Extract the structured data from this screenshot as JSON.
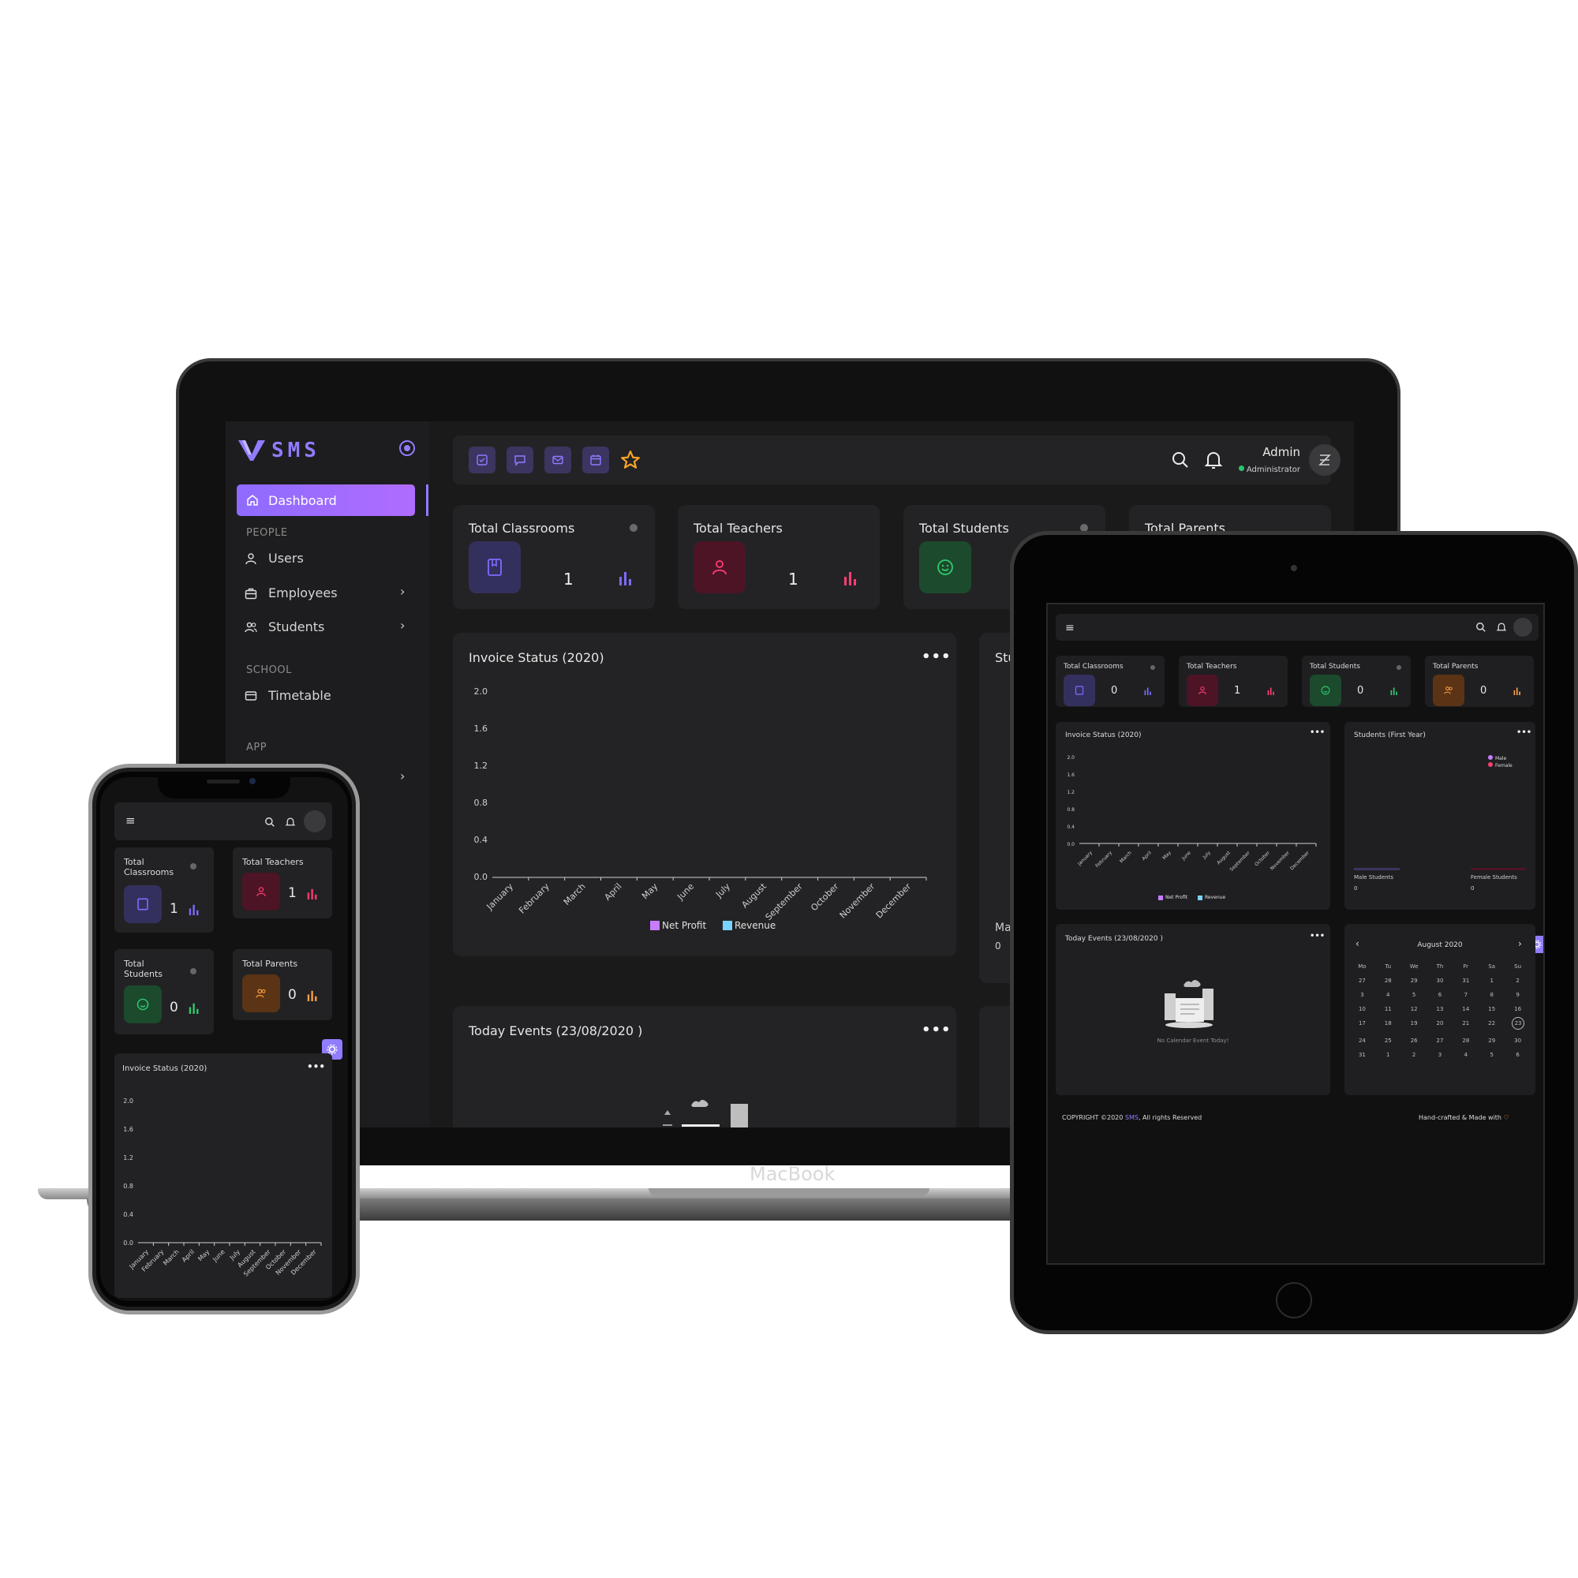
{
  "laptop": {
    "label": "MacBook",
    "app": {
      "logo_text": "SMS",
      "nav": {
        "dashboard": "Dashboard",
        "section_people": "PEOPLE",
        "users": "Users",
        "employees": "Employees",
        "students": "Students",
        "section_school": "SCHOOL",
        "timetable": "Timetable",
        "section_app": "APP"
      },
      "topbar": {
        "admin_name": "Admin",
        "admin_role": "Administrator"
      },
      "cards": [
        {
          "title": "Total Classrooms",
          "value": "1",
          "color": "#7b6cff"
        },
        {
          "title": "Total Teachers",
          "value": "1",
          "color": "#ff3d71"
        },
        {
          "title": "Total Students",
          "value": "",
          "color": "#2ecc71"
        },
        {
          "title": "Total Parents",
          "value": "",
          "color": "#ff9f43"
        }
      ],
      "invoice": {
        "title": "Invoice Status (2020)",
        "partial_title": "Stu",
        "partial_label": "Ma",
        "partial_value": "0"
      },
      "events": {
        "title": "Today Events (23/08/2020 )"
      }
    }
  },
  "chart_data": {
    "type": "bar",
    "title": "Invoice Status (2020)",
    "categories": [
      "January",
      "February",
      "March",
      "April",
      "May",
      "June",
      "July",
      "August",
      "September",
      "October",
      "November",
      "December"
    ],
    "series": [
      {
        "name": "Net Profit",
        "color": "#c77dff",
        "values": [
          0,
          0,
          0,
          0,
          0,
          0,
          0,
          0,
          0,
          0,
          0,
          0
        ]
      },
      {
        "name": "Revenue",
        "color": "#7ad3ff",
        "values": [
          0,
          0,
          0,
          0,
          0,
          0,
          0,
          0,
          0,
          0,
          0,
          0
        ]
      }
    ],
    "yticks": [
      "2.0",
      "1.6",
      "1.2",
      "0.8",
      "0.4",
      "0.0"
    ],
    "ylim": [
      0,
      2.0
    ],
    "legend": "bottom"
  },
  "tablet": {
    "cards": [
      {
        "title": "Total Classrooms",
        "value": "0"
      },
      {
        "title": "Total Teachers",
        "value": "1"
      },
      {
        "title": "Total Students",
        "value": "0"
      },
      {
        "title": "Total Parents",
        "value": "0"
      }
    ],
    "invoice_title": "Invoice Status (2020)",
    "students_title": "Students (First Year)",
    "students_legend": [
      "Male",
      "Female"
    ],
    "male_label": "Male Students",
    "male_value": "0",
    "female_label": "Female Students",
    "female_value": "0",
    "events_title": "Today Events (23/08/2020 )",
    "events_empty": "No Calendar Event Today!",
    "calendar": {
      "month": "August 2020",
      "weekdays": [
        "Mo",
        "Tu",
        "We",
        "Th",
        "Fr",
        "Sa",
        "Su"
      ],
      "rows": [
        [
          "27",
          "28",
          "29",
          "30",
          "31",
          "1",
          "2"
        ],
        [
          "3",
          "4",
          "5",
          "6",
          "7",
          "8",
          "9"
        ],
        [
          "10",
          "11",
          "12",
          "13",
          "14",
          "15",
          "16"
        ],
        [
          "17",
          "18",
          "19",
          "20",
          "21",
          "22",
          "23"
        ],
        [
          "24",
          "25",
          "26",
          "27",
          "28",
          "29",
          "30"
        ],
        [
          "31",
          "1",
          "2",
          "3",
          "4",
          "5",
          "6"
        ]
      ],
      "today": "23"
    },
    "footer_copyright_pre": "COPYRIGHT ©2020 ",
    "footer_brand": "SMS",
    "footer_copyright_post": ", All rights Reserved",
    "footer_right": "Hand-crafted & Made with"
  },
  "phone": {
    "cards": [
      {
        "title": "Total Classrooms",
        "value": "1"
      },
      {
        "title": "Total Teachers",
        "value": "1"
      },
      {
        "title": "Total Students",
        "value": "0"
      },
      {
        "title": "Total Parents",
        "value": "0"
      }
    ],
    "invoice_title": "Invoice Status (2020)"
  },
  "colors": {
    "accent": "#8f7cff",
    "teacher": "#ff3d71",
    "student": "#2ecc71",
    "parent": "#ff9f43"
  }
}
